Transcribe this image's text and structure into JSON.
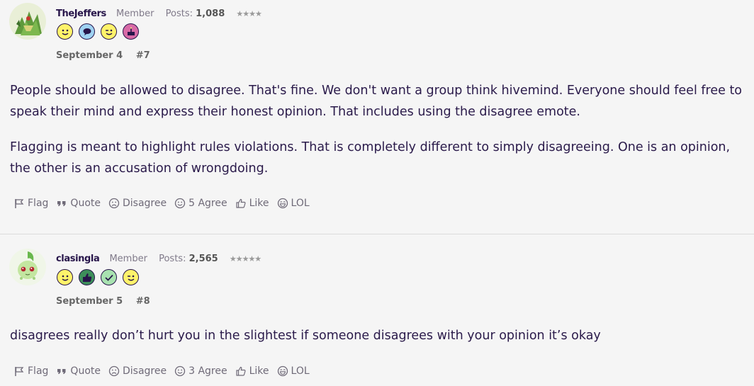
{
  "posts": [
    {
      "username": "TheJeffers",
      "role": "Member",
      "posts_label": "Posts:",
      "posts_count": "1,088",
      "stars": "★★★★",
      "badges": [
        "smile-badge-icon",
        "speech-bubble-badge-icon",
        "wink-badge-icon",
        "cake-badge-icon"
      ],
      "date": "September 4",
      "post_number": "#7",
      "paragraphs": [
        "People should be allowed to disagree. That's fine. We don't want a group think hivemind. Everyone should feel free to speak their mind and express their honest opinion. That includes using the disagree emote.",
        "Flagging is meant to highlight rules violations. That is completely different to simply disagreeing. One is an opinion, the other is an accusation of wrongdoing."
      ],
      "actions": {
        "flag": "Flag",
        "quote": "Quote",
        "disagree": "Disagree",
        "agree": "5 Agree",
        "like": "Like",
        "lol": "LOL"
      }
    },
    {
      "username": "clasingla",
      "role": "Member",
      "posts_label": "Posts:",
      "posts_count": "2,565",
      "stars": "★★★★★",
      "badges": [
        "smile-badge-icon",
        "thumbs-up-badge-icon",
        "check-badge-icon",
        "wink-badge-icon"
      ],
      "date": "September 5",
      "post_number": "#8",
      "paragraphs": [
        "disagrees really don’t hurt you in the slightest if someone disagrees with your opinion it’s okay"
      ],
      "actions": {
        "flag": "Flag",
        "quote": "Quote",
        "disagree": "Disagree",
        "agree": "3 Agree",
        "like": "Like",
        "lol": "LOL"
      }
    }
  ],
  "colors": {
    "background": "#f5f5f5",
    "text": "#27154a",
    "muted": "#6f6a78",
    "badge_yellow": "#fff36b",
    "badge_blue": "#9fd2f2",
    "badge_pink": "#d86aa7",
    "badge_green": "#3d8f5a",
    "badge_lightgreen": "#a8e2b0"
  }
}
